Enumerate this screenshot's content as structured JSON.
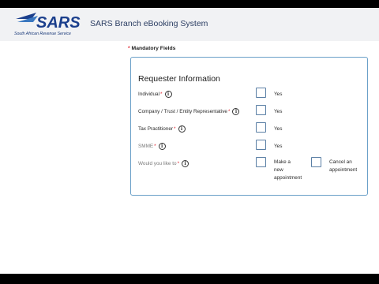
{
  "header": {
    "logo_text": "SARS",
    "logo_tagline": "South African Revenue Service",
    "app_title": "SARS Branch eBooking System",
    "brand_color": "#1b3f8c"
  },
  "form": {
    "mandatory_star": "*",
    "mandatory_label": "Mandatory Fields",
    "section_title": "Requester Information",
    "rows": [
      {
        "label": "Individual",
        "required": "*",
        "option": "Yes"
      },
      {
        "label": "Company / Trust / Entity Representative",
        "required": "*",
        "option": "Yes"
      },
      {
        "label": "Tax Practitioner",
        "required": "*",
        "option": "Yes"
      },
      {
        "label": "SMME",
        "required": "*",
        "option": "Yes"
      },
      {
        "label": "Would you like to",
        "required": "*",
        "options": [
          "Make a new appointment",
          "Cancel an appointment"
        ]
      }
    ],
    "info_icon_glyph": "i",
    "border_color": "#6aa0c8"
  }
}
